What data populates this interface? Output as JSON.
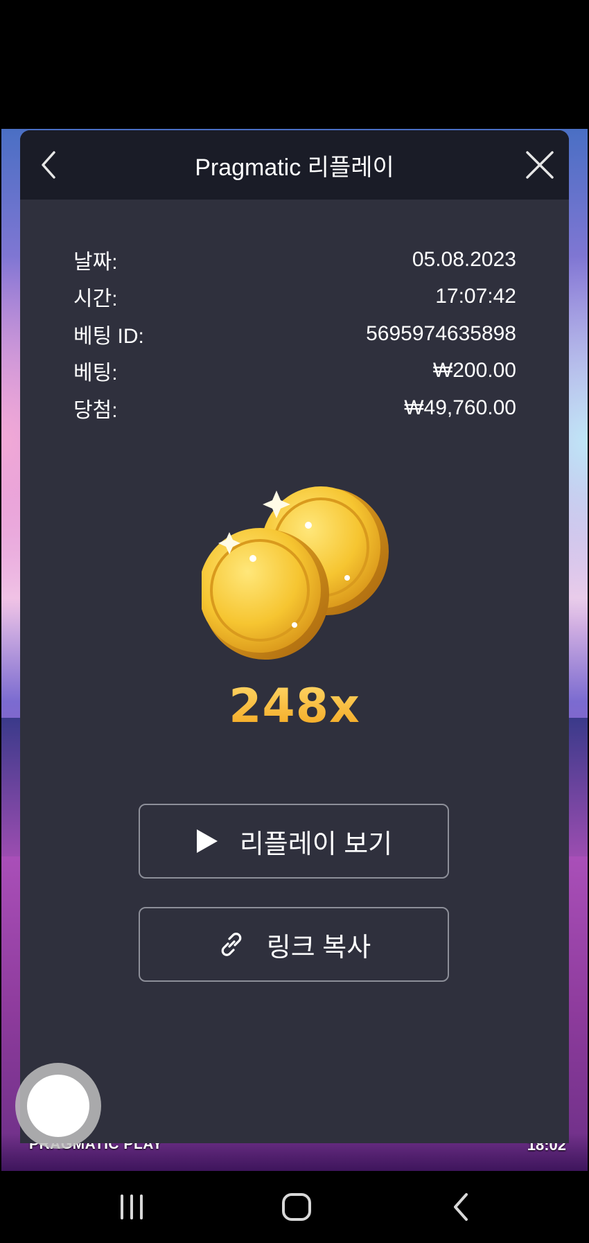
{
  "game": {
    "brand": "PRAGMATIC PLAY",
    "clock": "18:02"
  },
  "modal": {
    "title": "Pragmatic 리플레이",
    "rows": [
      {
        "label": "날짜:",
        "value": "05.08.2023"
      },
      {
        "label": "시간:",
        "value": "17:07:42"
      },
      {
        "label": "베팅 ID:",
        "value": "5695974635898"
      },
      {
        "label": "베팅:",
        "value": "₩200.00"
      },
      {
        "label": "당첨:",
        "value": "₩49,760.00"
      }
    ],
    "multiplier": "248x",
    "replay_label": "리플레이 보기",
    "copy_link_label": "링크 복사"
  },
  "icons": {
    "back": "chevron-left-icon",
    "close": "close-icon",
    "replay": "play-icon",
    "copy": "link-icon",
    "nav_recent": "recent-apps-icon",
    "nav_home": "home-icon",
    "nav_back": "back-icon"
  },
  "colors": {
    "modal_bg": "#2f303d",
    "header_bg": "#1a1c27",
    "multiplier": "#f3b533"
  }
}
